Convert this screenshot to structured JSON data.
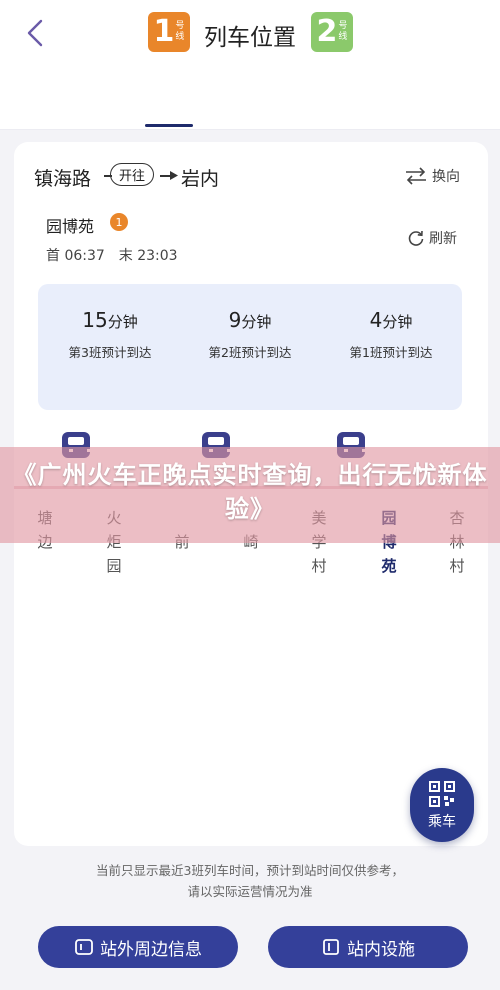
{
  "header": {
    "title": "列车位置"
  },
  "line_tabs": [
    {
      "number": "1",
      "suffix_top": "号",
      "suffix_bottom": "线",
      "color": "#e9862a",
      "active": true
    },
    {
      "number": "2",
      "suffix_top": "号",
      "suffix_bottom": "线",
      "color": "#8bc96b",
      "active": false
    }
  ],
  "route": {
    "from": "镇海路",
    "direction": "开往",
    "to": "岩内",
    "switch_label": "换向",
    "switch_icon": "swap-icon"
  },
  "station": {
    "name": "园博苑",
    "exit_badge": "1",
    "first_train": "首 06:37",
    "last_train": "末 23:03",
    "refresh_label": "刷新"
  },
  "arrivals": [
    {
      "minutes": "15",
      "unit": "分钟",
      "label": "第3班预计到达"
    },
    {
      "minutes": "9",
      "unit": "分钟",
      "label": "第2班预计到达"
    },
    {
      "minutes": "4",
      "unit": "分钟",
      "label": "第1班预计到达"
    }
  ],
  "stops": [
    {
      "name": "塘边",
      "current": false
    },
    {
      "name": "火炬园",
      "current": false
    },
    {
      "name": "前",
      "current": false
    },
    {
      "name": "崎",
      "current": false
    },
    {
      "name": "美学村",
      "current": false
    },
    {
      "name": "园博苑",
      "current": true
    },
    {
      "name": "杏林村",
      "current": false
    }
  ],
  "overlay_title": "《广州火车正晚点实时查询，出行无忧新体验》",
  "ride_button": {
    "label": "乘车",
    "icon": "qr-code-icon"
  },
  "disclaimer": {
    "line1": "当前只显示最近3班列车时间，预计到站时间仅供参考，",
    "line2": "请以实际运营情况为准"
  },
  "bottom_buttons": [
    {
      "label": "站外周边信息",
      "icon": "outside-info-icon"
    },
    {
      "label": "站内设施",
      "icon": "facility-icon"
    }
  ],
  "colors": {
    "primary": "#34409a",
    "line1": "#e9862a",
    "line2": "#8bc96b",
    "overlay": "#e096a2"
  }
}
